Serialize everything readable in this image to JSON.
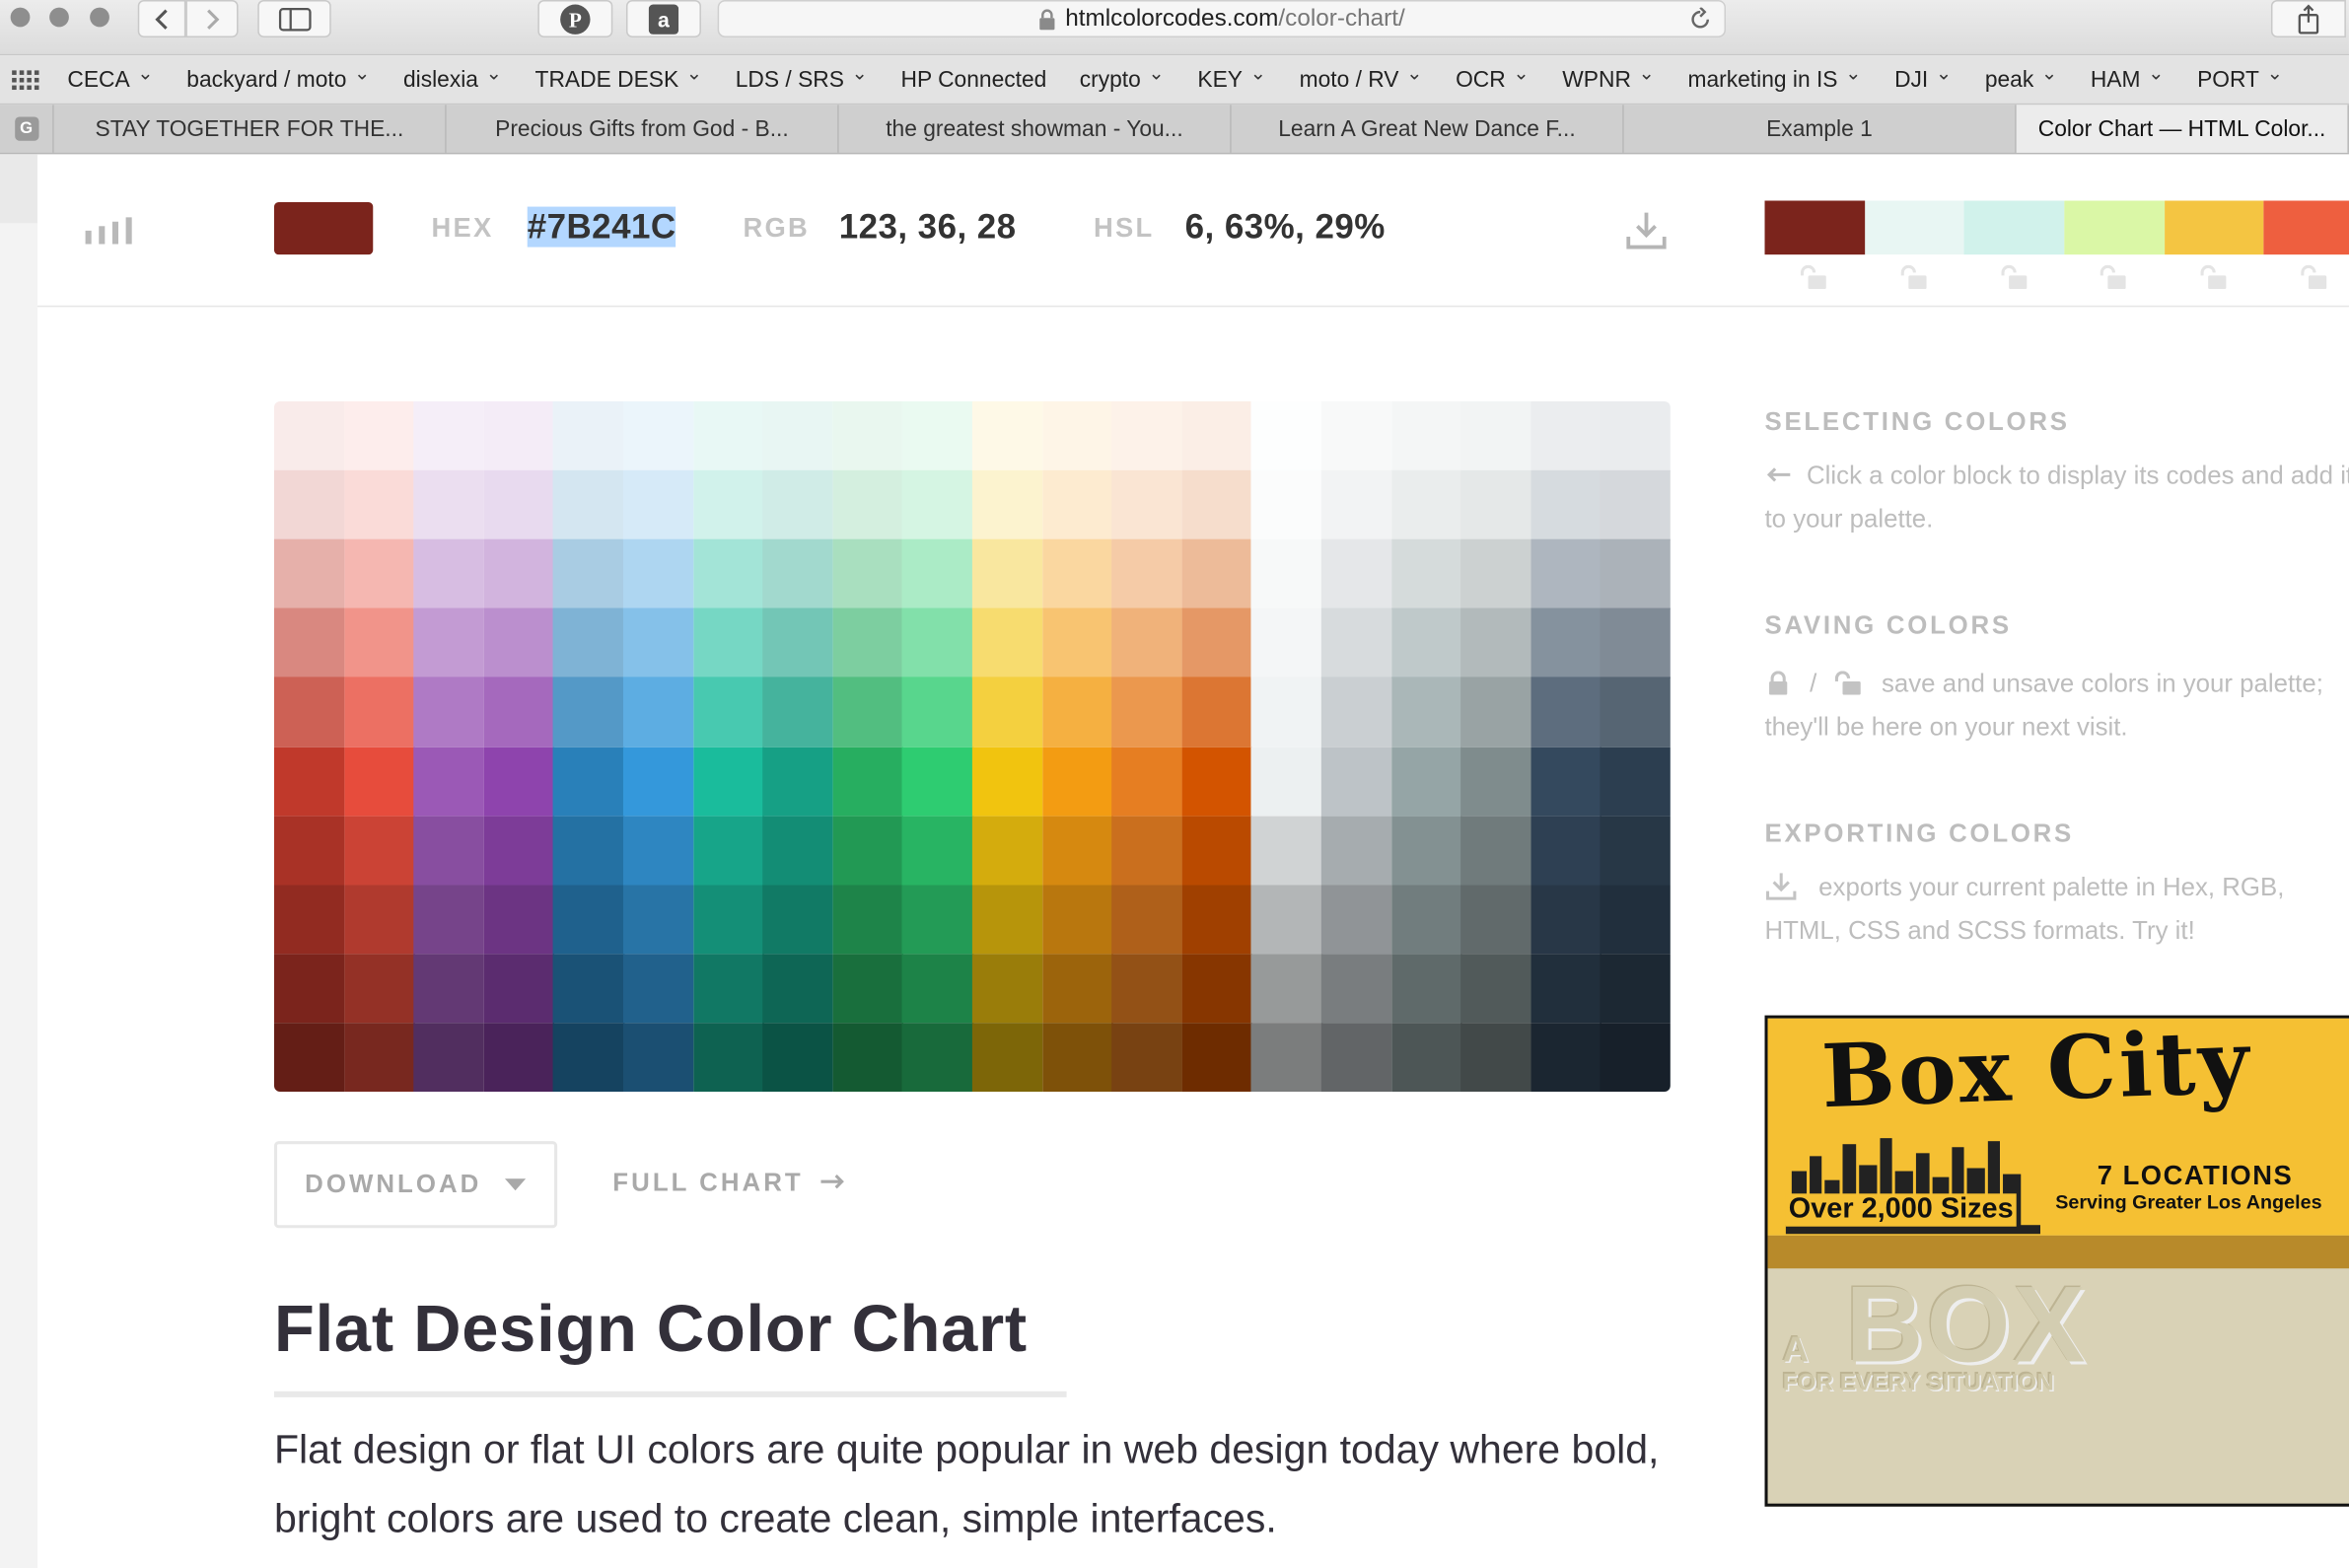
{
  "browser": {
    "url_host": "htmlcolorcodes.com",
    "url_path": "/color-chart/",
    "bookmarks": [
      {
        "label": "CECA",
        "menu": true
      },
      {
        "label": "backyard / moto",
        "menu": true
      },
      {
        "label": "dislexia",
        "menu": true
      },
      {
        "label": "TRADE DESK",
        "menu": true
      },
      {
        "label": "LDS / SRS",
        "menu": true
      },
      {
        "label": "HP Connected",
        "menu": false
      },
      {
        "label": "crypto",
        "menu": true
      },
      {
        "label": "KEY",
        "menu": true
      },
      {
        "label": "moto / RV",
        "menu": true
      },
      {
        "label": "OCR",
        "menu": true
      },
      {
        "label": "WPNR",
        "menu": true
      },
      {
        "label": "marketing in IS",
        "menu": true
      },
      {
        "label": "DJI",
        "menu": true
      },
      {
        "label": "peak",
        "menu": true
      },
      {
        "label": "HAM",
        "menu": true
      },
      {
        "label": "PORT",
        "menu": true
      }
    ],
    "tabs": [
      {
        "label": "STAY TOGETHER FOR THE...",
        "active": false
      },
      {
        "label": "Precious Gifts from God - B...",
        "active": false
      },
      {
        "label": "the greatest showman - You...",
        "active": false
      },
      {
        "label": "Learn A Great New Dance F...",
        "active": false
      },
      {
        "label": "Example 1",
        "active": false
      },
      {
        "label": "Color Chart — HTML Color...",
        "active": true
      }
    ],
    "tab_group_icon": "G"
  },
  "selected_color": {
    "swatch": "#7B241C",
    "hex_label": "HEX",
    "hex_value": "#7B241C",
    "rgb_label": "RGB",
    "rgb_value": "123, 36, 28",
    "hsl_label": "HSL",
    "hsl_value": "6, 63%, 29%"
  },
  "palette": [
    "#7B241C",
    "#E8F6F3",
    "#D1F2EB",
    "#DAF7A6",
    "#F4C542",
    "#EE5F3F"
  ],
  "chart": {
    "columns": [
      [
        "#F9EBEA",
        "#F2D7D5",
        "#E6B0AA",
        "#D98880",
        "#CD6155",
        "#C0392B",
        "#A93226",
        "#922B21",
        "#7B241C",
        "#641E16"
      ],
      [
        "#FDEDEC",
        "#FADBD8",
        "#F5B7B1",
        "#F1948A",
        "#EC7063",
        "#E74C3C",
        "#CB4335",
        "#B03A2E",
        "#943126",
        "#78281F"
      ],
      [
        "#F5EEF8",
        "#EBDEF0",
        "#D7BDE2",
        "#C39BD3",
        "#AF7AC5",
        "#9B59B6",
        "#884EA0",
        "#76448A",
        "#633974",
        "#512E5F"
      ],
      [
        "#F4ECF7",
        "#E8DAEF",
        "#D2B4DE",
        "#BB8FCE",
        "#A569BD",
        "#8E44AD",
        "#7D3C98",
        "#6C3483",
        "#5B2C6F",
        "#4A235A"
      ],
      [
        "#EAF2F8",
        "#D4E6F1",
        "#A9CCE3",
        "#7FB3D5",
        "#5499C7",
        "#2980B9",
        "#2471A3",
        "#1F618D",
        "#1A5276",
        "#154360"
      ],
      [
        "#EBF5FB",
        "#D6EAF8",
        "#AED6F1",
        "#85C1E9",
        "#5DADE2",
        "#3498DB",
        "#2E86C1",
        "#2874A6",
        "#21618C",
        "#1B4F72"
      ],
      [
        "#E8F8F5",
        "#D1F2EB",
        "#A3E4D7",
        "#76D7C4",
        "#48C9B0",
        "#1ABC9C",
        "#17A589",
        "#148F77",
        "#117864",
        "#0E6251"
      ],
      [
        "#E8F6F3",
        "#D0ECE7",
        "#A2D9CE",
        "#73C6B6",
        "#45B39D",
        "#16A085",
        "#138D75",
        "#117A65",
        "#0E6655",
        "#0B5345"
      ],
      [
        "#E9F7EF",
        "#D4EFDF",
        "#A9DFBF",
        "#7DCEA0",
        "#52BE80",
        "#27AE60",
        "#229954",
        "#1E8449",
        "#196F3D",
        "#145A32"
      ],
      [
        "#EAFAF1",
        "#D5F5E3",
        "#ABEBC6",
        "#82E0AA",
        "#58D68D",
        "#2ECC71",
        "#28B463",
        "#239B56",
        "#1D8348",
        "#186A3B"
      ],
      [
        "#FEF9E7",
        "#FCF3CF",
        "#F9E79F",
        "#F7DC6F",
        "#F4D03F",
        "#F1C40F",
        "#D4AC0D",
        "#B7950B",
        "#9A7D0A",
        "#7D6608"
      ],
      [
        "#FEF5E7",
        "#FDEBD0",
        "#FAD7A0",
        "#F8C471",
        "#F5B041",
        "#F39C12",
        "#D68910",
        "#B9770E",
        "#9C640C",
        "#7E5109"
      ],
      [
        "#FDF2E9",
        "#FAE5D3",
        "#F5CBA7",
        "#F0B27A",
        "#EB984E",
        "#E67E22",
        "#CA6F1E",
        "#AF601A",
        "#935116",
        "#784212"
      ],
      [
        "#FBEEE6",
        "#F6DDCC",
        "#EDBB99",
        "#E59866",
        "#DC7633",
        "#D35400",
        "#BA4A00",
        "#A04000",
        "#873600",
        "#6E2C00"
      ],
      [
        "#FDFEFE",
        "#FBFCFC",
        "#F7F9F9",
        "#F4F6F7",
        "#F0F3F4",
        "#ECF0F1",
        "#D0D3D4",
        "#B3B6B7",
        "#979A9A",
        "#7B7D7D"
      ],
      [
        "#F8F9F9",
        "#F2F3F4",
        "#E5E7E9",
        "#D7DBDD",
        "#CACFD2",
        "#BDC3C7",
        "#A6ACAF",
        "#909497",
        "#797D7F",
        "#626567"
      ],
      [
        "#F4F6F6",
        "#EAEDED",
        "#D5DBDB",
        "#BFC9CA",
        "#AAB7B8",
        "#95A5A6",
        "#839192",
        "#717D7E",
        "#5F6A6A",
        "#4D5656"
      ],
      [
        "#F2F4F4",
        "#E5E8E8",
        "#CCD1D1",
        "#B2BABB",
        "#99A3A4",
        "#7F8C8D",
        "#707B7C",
        "#616A6B",
        "#515A5A",
        "#424949"
      ],
      [
        "#EBEDEF",
        "#D6DBDF",
        "#AEB6BF",
        "#85929E",
        "#5D6D7E",
        "#34495E",
        "#2E4053",
        "#283747",
        "#212F3C",
        "#1B2631"
      ],
      [
        "#EAECEE",
        "#D5D8DC",
        "#ABB2B9",
        "#808B96",
        "#566573",
        "#2C3E50",
        "#273746",
        "#212F3D",
        "#1C2833",
        "#17202A"
      ]
    ]
  },
  "actions": {
    "download_label": "DOWNLOAD",
    "full_chart_label": "FULL CHART"
  },
  "article": {
    "title": "Flat Design Color Chart",
    "intro": "Flat design or flat UI colors are quite popular in web design today where bold, bright colors are used to create clean, simple interfaces."
  },
  "sidebar": {
    "selecting_title": "SELECTING COLORS",
    "selecting_text": "Click a color block to display its codes and add it to your palette.",
    "saving_title": "SAVING COLORS",
    "saving_sep": "/",
    "saving_text": "save and unsave colors in your palette; they'll be here on your next visit.",
    "exporting_title": "EXPORTING COLORS",
    "exporting_text": "exports your current palette in Hex, RGB, HTML, CSS and SCSS formats. Try it!"
  },
  "ad": {
    "brand": "Box City",
    "tagline": "Over 2,000 Sizes",
    "locations": "7 LOCATIONS",
    "serving": "Serving Greater Los Angeles",
    "watermark_a": "A",
    "watermark_box": "BOX",
    "watermark_sub": "FOR EVERY SITUATION"
  }
}
